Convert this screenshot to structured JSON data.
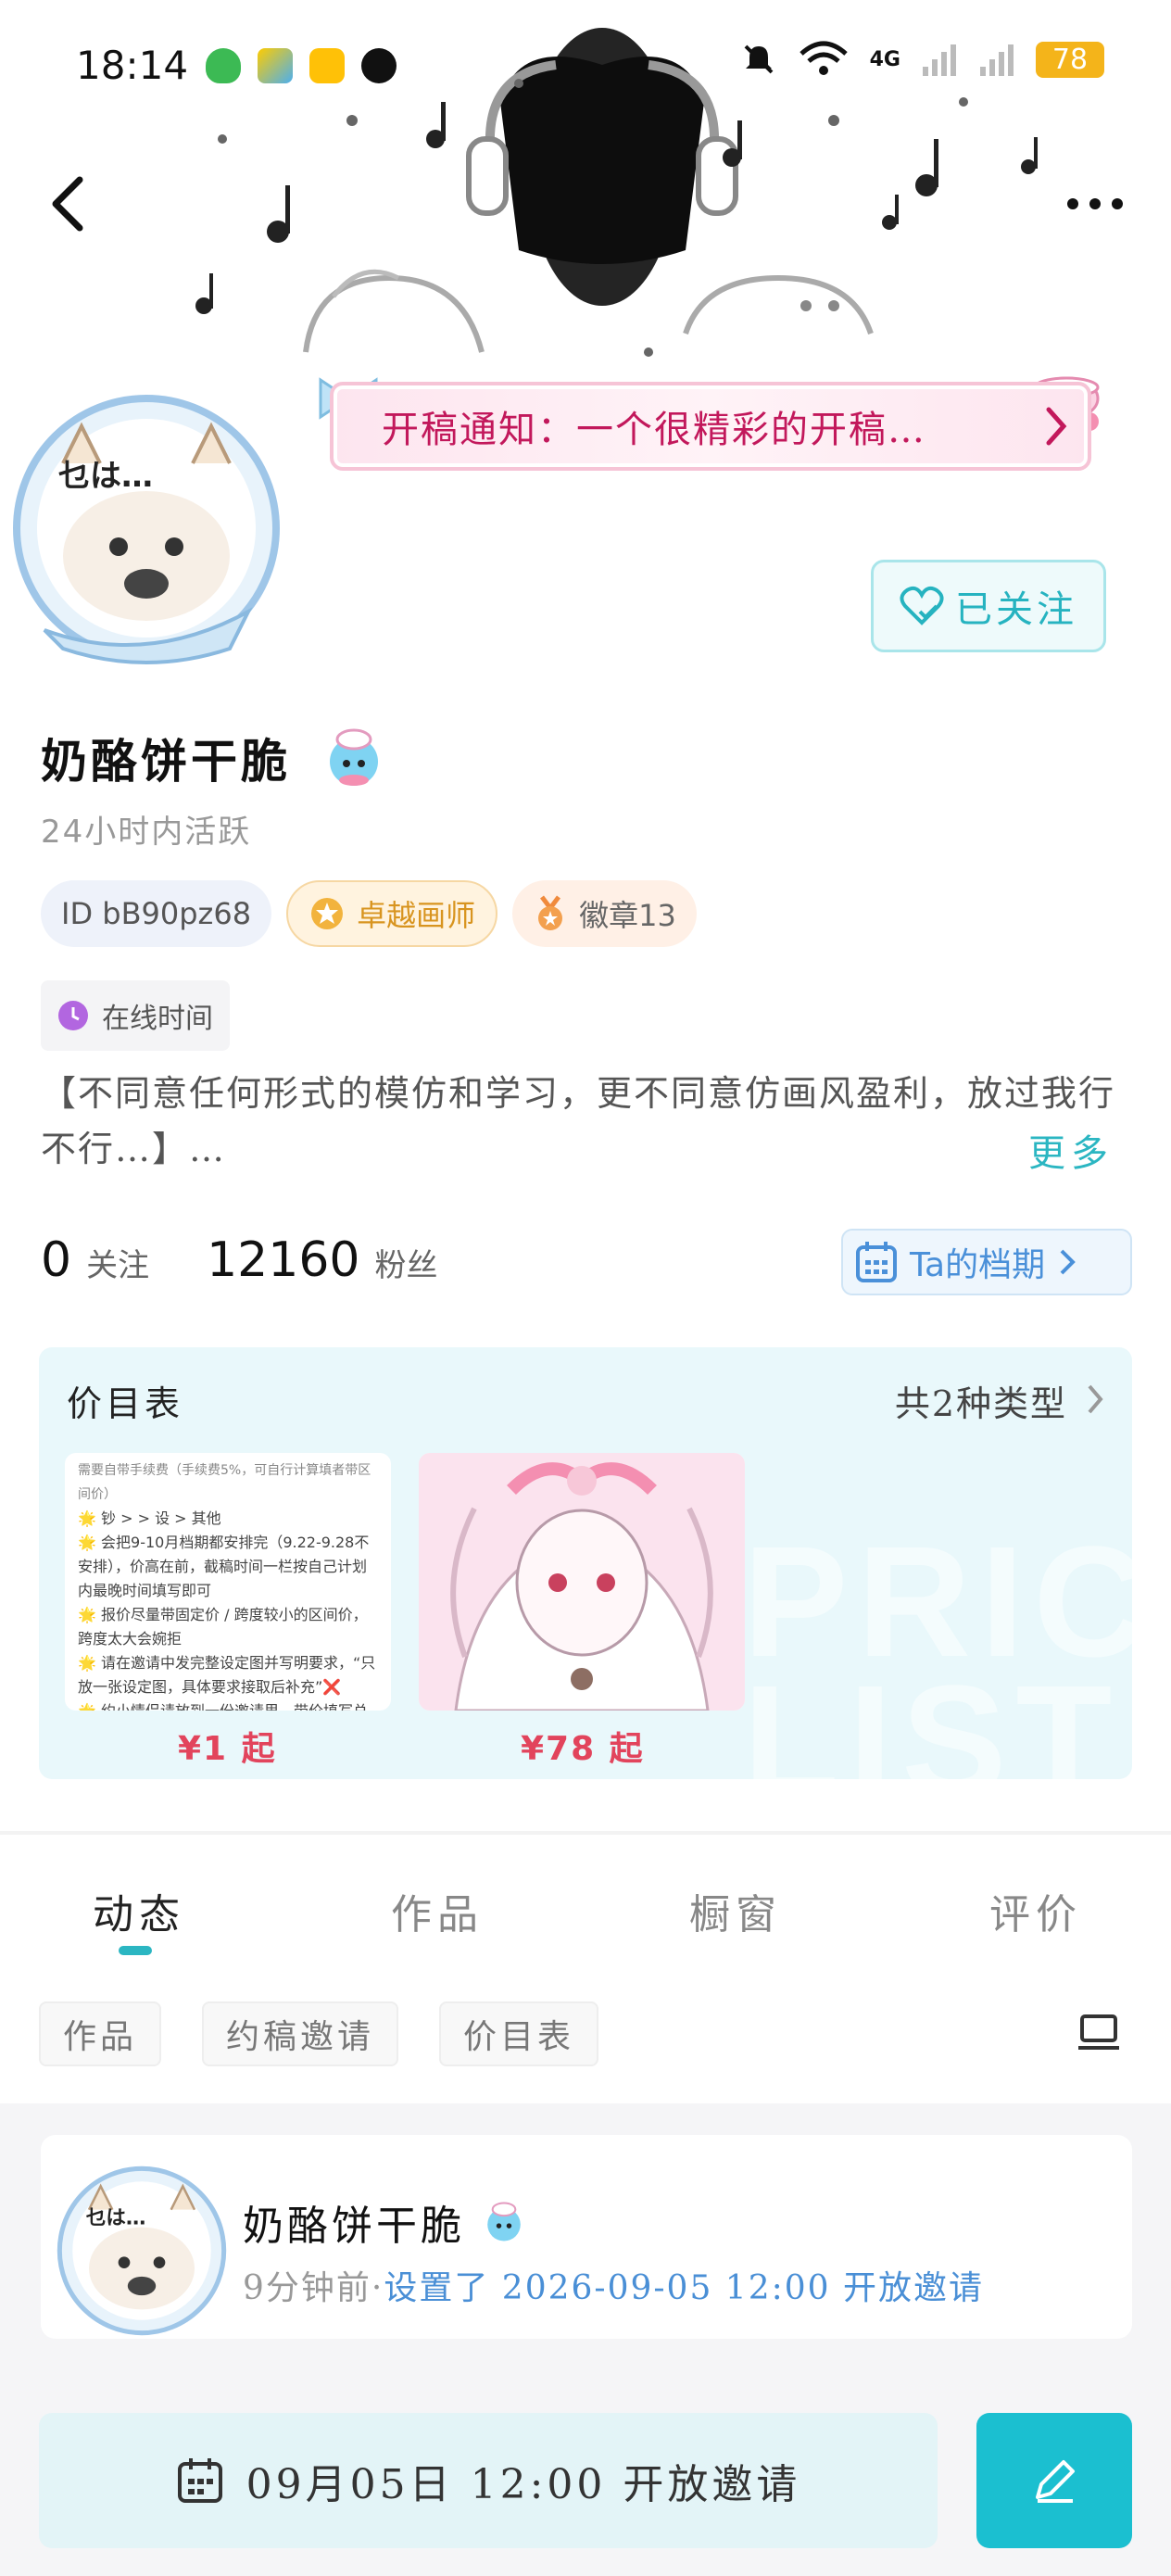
{
  "status_bar": {
    "time": "18:14",
    "network": "4G",
    "battery": "78"
  },
  "notice": {
    "text": "开稿通知：一个很精彩的开稿…"
  },
  "follow_button": {
    "label": "已关注"
  },
  "profile": {
    "username": "奶酪饼干脆",
    "active_status": "24小时内活跃",
    "id_tag": "ID bB90pz68",
    "pro_tag": "卓越画师",
    "badge_tag": "徽章13",
    "online_time": "在线时间",
    "bio": "【不同意任何形式的模仿和学习，更不同意仿画风盈利，放过我行不行…】…",
    "more_label": "更多"
  },
  "stats": {
    "following_count": "0",
    "following_label": "关注",
    "followers_count": "12160",
    "followers_label": "粉丝",
    "schedule_label": "Ta的档期"
  },
  "price_list": {
    "title": "价目表",
    "count_label": "共2种类型",
    "items": [
      {
        "price": "¥1 起",
        "notes": [
          "需要自带手续费（手续费5%，可自行计算填者带区间价）",
          "🌟 钞 > > 设 > 其他",
          "🌟 会把9-10月档期都安排完（9.22-9.28不安排），价高在前，截稿时间一栏按自己计划内最晚时间填写即可",
          "🌟 报价尽量带固定价 / 跨度较小的区间价，跨度太大会婉拒",
          "🌟 请在邀请中发完整设定图并写明要求，“只放一张设定图，具体要求接取后补充”❌",
          "🌟 约小情侣请放到一份邀请里，带价填写总价"
        ]
      },
      {
        "price": "¥78 起"
      }
    ],
    "watermark": "PRICE LIST"
  },
  "tabs": [
    {
      "label": "动态",
      "active": true
    },
    {
      "label": "作品",
      "active": false
    },
    {
      "label": "橱窗",
      "active": false
    },
    {
      "label": "评价",
      "active": false
    }
  ],
  "filters": [
    "作品",
    "约稿邀请",
    "价目表"
  ],
  "feed": {
    "name": "奶酪饼干脆",
    "time_ago": "9分钟前",
    "separator": "·",
    "action": "设置了 2026-09-05 12:00 开放邀请"
  },
  "bottom": {
    "invite_label": "09月05日  12:00 开放邀请"
  },
  "colors": {
    "accent": "#2bb6c2",
    "price": "#e2445c",
    "link": "#4a8fd6",
    "edit_button": "#1bbfd0"
  }
}
